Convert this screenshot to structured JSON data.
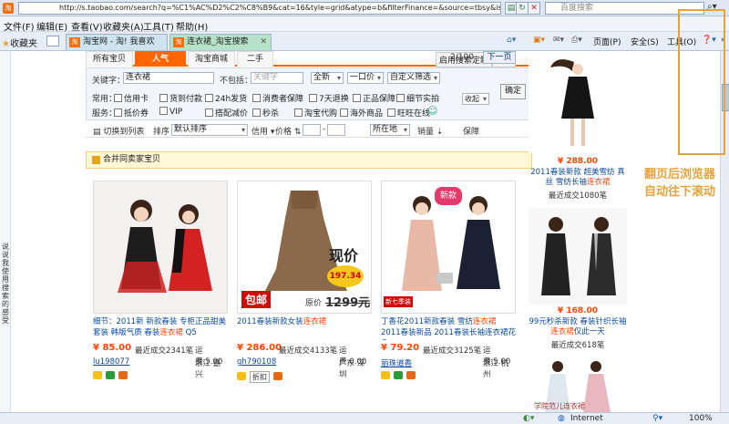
{
  "address_bar": {
    "url": "http://s.taobao.com/search?q=%C1%AC%D2%C2%C8%B9&cat=16&tyle=grid&atype=b&filterFinance=&source=tbsy&isprepay=yes&bcoffset=1&ref=",
    "search_placeholder": "百度搜索"
  },
  "menu": [
    "文件(F)",
    "编辑(E)",
    "查看(V)",
    "收藏夹(A)",
    "工具(T)",
    "帮助(H)"
  ],
  "favbar": {
    "label": "收藏夹",
    "tabs": [
      {
        "label": "淘宝网 - 淘! 我喜欢"
      },
      {
        "label": "连衣裙_淘宝搜索"
      }
    ],
    "tools": [
      "页面(P)",
      "安全(S)",
      "工具(O)"
    ],
    "more": "»"
  },
  "side_feedback": "说说我使用搜索的感受",
  "search_tabs": [
    "所有宝贝",
    "人气",
    "淘宝商城",
    "二手"
  ],
  "customize_btn": "启用搜索定制",
  "settings_btn": "设置",
  "pager": {
    "text": "2/100",
    "next": "下一页"
  },
  "filter": {
    "keyword_label": "关键字：",
    "keyword_value": "连衣裙",
    "exclude_label": "不包括：",
    "exclude_placeholder": "关键字",
    "scope": "全新",
    "price": "一口价",
    "custom": "自定义筛选",
    "confirm": "确定",
    "common_label": "常用：",
    "common_opts": [
      "信用卡",
      "货到付款",
      "24h发货",
      "消费者保障",
      "7天退换",
      "正品保障",
      "细节实拍"
    ],
    "collapse": "收起",
    "service_label": "服务：",
    "service_opts": [
      "抵价券",
      "VIP",
      "搭配减价",
      "秒杀",
      "淘宝代购",
      "海外商品",
      "旺旺在线"
    ]
  },
  "sortbar": {
    "list_view": "切换到列表",
    "sort_label": "排序",
    "sort_value": "默认排序",
    "credit": "信用",
    "price": "价格",
    "location": "所在地",
    "sales": "销量",
    "guarantee": "保障"
  },
  "merge_text": "合并同卖家宝贝",
  "products": [
    {
      "title_a": "细节：2011新 新款春装 专柜正品甜美套装 韩版气质 春装",
      "title_hl": "连衣裙",
      "title_b": " Q5",
      "price": "¥ 85.00",
      "sold": "最近成交2341笔",
      "shipping": "运费:5.00",
      "seller": "lu198077",
      "location": "浙江 嘉兴"
    },
    {
      "title_a": "2011春装新款女装",
      "title_hl": "连衣裙",
      "title_b": "",
      "price": "¥ 286.00",
      "sold": "最近成交4133笔",
      "shipping": "运费:0.00",
      "seller": "gh790108",
      "location": "广东 深圳",
      "tag": "折扣"
    },
    {
      "title_a": "丁香花2011新款春装 雪纺",
      "title_hl": "连衣裙",
      "title_b": " 2011春装新品 2011春装长袖连衣裙花色",
      "price": "¥ 79.20",
      "sold": "最近成交3125笔",
      "shipping": "运费:5.00",
      "seller": "丽珠道香",
      "location": "浙江 杭州"
    }
  ],
  "product_overlays": {
    "sale": "现价",
    "price_tag": "197.34",
    "orig": "原价",
    "orig_price": "1299元",
    "baoyou": "包邮",
    "new": "新款",
    "season": "新七季装"
  },
  "side_products": [
    {
      "price": "¥ 288.00",
      "title_a": "2011春装新款 超美雪纺 真丝 雪纺长袖",
      "title_hl": "连衣裙",
      "sold": "最近成交1080笔"
    },
    {
      "price": "¥ 168.00",
      "title_a": "99元秒杀新款 春装针织长袖 ",
      "title_hl": "连衣裙",
      "title_b": "仅此一天",
      "sold": "最近成交618笔"
    },
    {
      "caption": "学院范儿连衣裙"
    }
  ],
  "annotation": {
    "line1": "翻页后浏览器",
    "line2": "自动往下滚动"
  },
  "status": {
    "zone": "Internet",
    "zoom": "100%"
  },
  "colors": {
    "accent": "#ff6600",
    "link": "#0a4a9e",
    "price": "#ff4400",
    "annotation": "#e7a33a"
  }
}
